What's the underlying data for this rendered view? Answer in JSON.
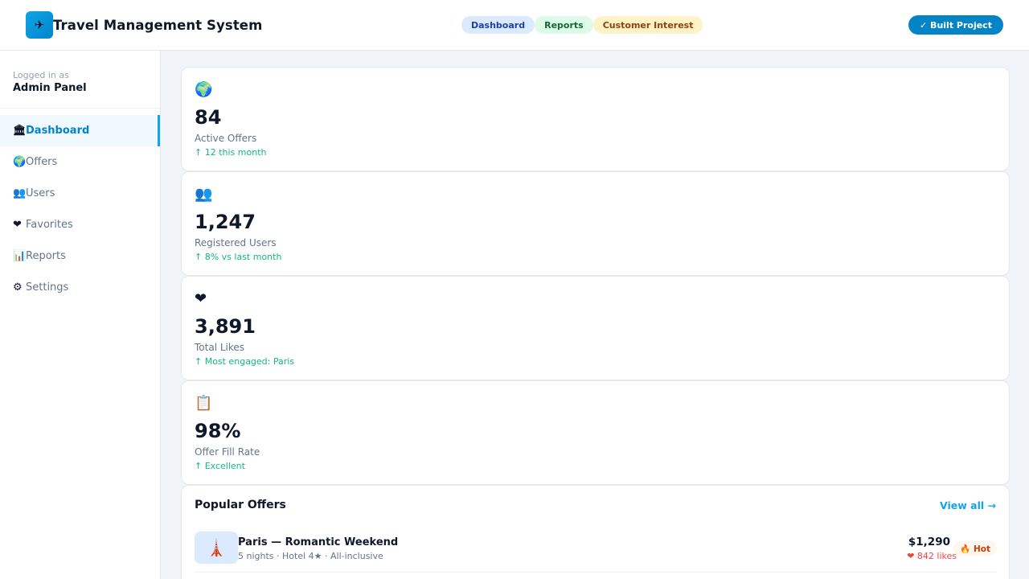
{
  "header": {
    "logo_glyph": "✈",
    "title": "Travel Management System",
    "pills": [
      "Dashboard",
      "Reports",
      "Customer Interest"
    ],
    "built_label": "✓ Built Project"
  },
  "sidebar": {
    "logged_in_label": "Logged in as",
    "user_name": "Admin Panel",
    "items": [
      {
        "icon": "🏛",
        "label": "Dashboard"
      },
      {
        "icon": "🌍",
        "label": "Offers"
      },
      {
        "icon": "👥",
        "label": "Users"
      },
      {
        "icon": "❤",
        "label": "Favorites"
      },
      {
        "icon": "📊",
        "label": "Reports"
      },
      {
        "icon": "⚙",
        "label": "Settings"
      }
    ]
  },
  "stats": [
    {
      "icon": "🌍",
      "value": "84",
      "label": "Active Offers",
      "trend": "↑ 12 this month"
    },
    {
      "icon": "👥",
      "value": "1,247",
      "label": "Registered Users",
      "trend": "↑ 8% vs last month"
    },
    {
      "icon": "❤",
      "value": "3,891",
      "label": "Total Likes",
      "trend": "↑ Most engaged: Paris"
    },
    {
      "icon": "📋",
      "value": "98%",
      "label": "Offer Fill Rate",
      "trend": "↑ Excellent"
    }
  ],
  "popular_offers": {
    "title": "Popular Offers",
    "view_all": "View all →",
    "items": [
      {
        "thumb": "🗼",
        "name": "Paris — Romantic Weekend",
        "meta": "5 nights · Hotel 4★ · All-inclusive",
        "price": "$1,290",
        "likes": "❤ 842 likes",
        "badge": "🔥 Hot"
      }
    ]
  },
  "colors": {
    "accent": "#0ea5e9",
    "accent_dark": "#0284c7",
    "trend_green": "#10b981",
    "likes_red": "#ef4444"
  }
}
